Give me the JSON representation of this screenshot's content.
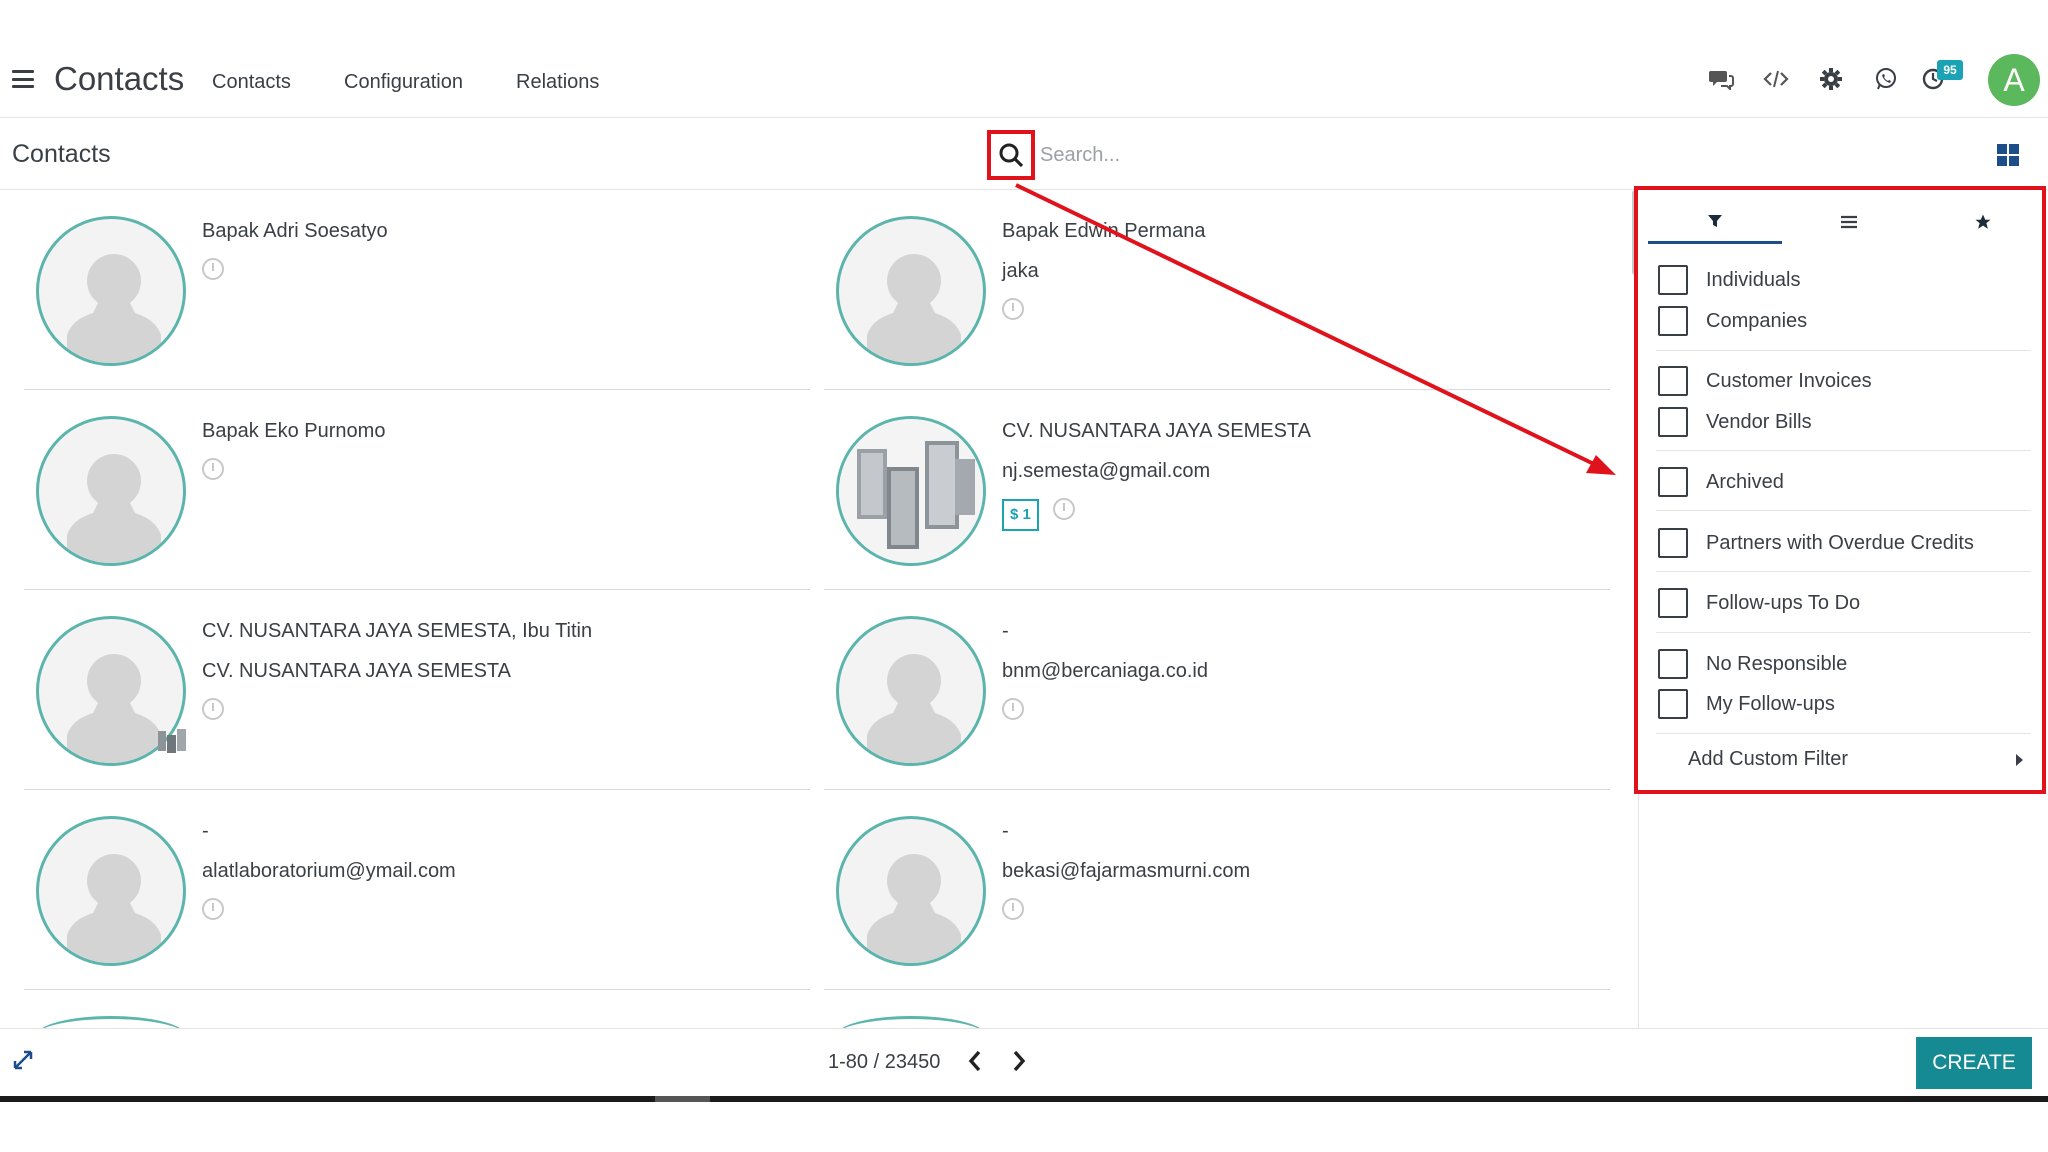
{
  "nav": {
    "app_title": "Contacts",
    "menu": [
      "Contacts",
      "Configuration",
      "Relations"
    ],
    "notification_count": "95",
    "user_initial": "A",
    "icons": [
      "chat-icon",
      "code-icon",
      "gear-icon",
      "whatsapp-icon",
      "activity-clock-icon"
    ]
  },
  "control": {
    "breadcrumb": "Contacts",
    "search_placeholder": "Search..."
  },
  "contacts": [
    {
      "lines": [
        "Bapak Adri Soesatyo"
      ],
      "type": "person"
    },
    {
      "lines": [
        "Bapak Edwin Permana",
        "jaka"
      ],
      "type": "person"
    },
    {
      "lines": [
        "Bapak Eko Purnomo"
      ],
      "type": "person"
    },
    {
      "lines": [
        "CV. NUSANTARA JAYA SEMESTA",
        "nj.semesta@gmail.com"
      ],
      "type": "company",
      "tag": "$ 1"
    },
    {
      "lines": [
        "CV. NUSANTARA JAYA SEMESTA, Ibu Titin",
        "CV. NUSANTARA JAYA SEMESTA"
      ],
      "type": "person-with-company"
    },
    {
      "lines": [
        "-",
        "bnm@bercaniaga.co.id"
      ],
      "type": "person"
    },
    {
      "lines": [
        "-",
        "alatlaboratorium@ymail.com"
      ],
      "type": "person"
    },
    {
      "lines": [
        "-",
        "bekasi@fajarmasmurni.com"
      ],
      "type": "person"
    }
  ],
  "filters": {
    "tabs": [
      "filter-icon",
      "group-by-icon",
      "favorites-star-icon"
    ],
    "options": [
      "Individuals",
      "Companies",
      "Customer Invoices",
      "Vendor Bills",
      "Archived",
      "Partners with Overdue Credits",
      "Follow-ups To Do",
      "No Responsible",
      "My Follow-ups"
    ],
    "custom_filter": "Add Custom Filter"
  },
  "pager": {
    "text": "1-80 / 23450"
  },
  "actions": {
    "create": "CREATE"
  },
  "colors": {
    "accent": "#168a93",
    "annotation": "#e0121b",
    "avatar_border": "#5bb5ad",
    "user_avatar": "#5cb85c"
  }
}
